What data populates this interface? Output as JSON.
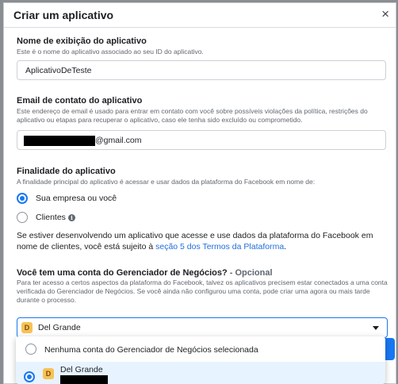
{
  "dialog": {
    "title": "Criar um aplicativo",
    "close_glyph": "×"
  },
  "display_name": {
    "title": "Nome de exibição do aplicativo",
    "description": "Este é o nome do aplicativo associado ao seu ID do aplicativo.",
    "value": "AplicativoDeTeste"
  },
  "contact_email": {
    "title": "Email de contato do aplicativo",
    "description": "Este endereço de email é usado para entrar em contato com você sobre possíveis violações da política, restrições do aplicativo ou etapas para recuperar o aplicativo, caso ele tenha sido excluído ou comprometido.",
    "value_suffix": "@gmail.com"
  },
  "purpose": {
    "title": "Finalidade do aplicativo",
    "description": "A finalidade principal do aplicativo é acessar e usar dados da plataforma do Facebook em nome de:",
    "options": [
      {
        "label": "Sua empresa ou você",
        "selected": true
      },
      {
        "label": "Clientes",
        "selected": false,
        "icon": "info-icon"
      }
    ],
    "note_prefix": "Se estiver desenvolvendo um aplicativo que acesse e use dados da plataforma do Facebook em nome de clientes, você está sujeito à ",
    "note_link": "seção 5 dos Termos da Plataforma",
    "note_suffix": "."
  },
  "business": {
    "title": "Você tem uma conta do Gerenciador de Negócios?",
    "optional": " - Opcional",
    "description": "Para ter acesso a certos aspectos da plataforma do Facebook, talvez os aplicativos precisem estar conectados a uma conta verificada do Gerenciador de Negócios. Se você ainda não configurou uma conta, pode criar uma agora ou mais tarde durante o processo.",
    "selected": {
      "badge": "D",
      "label": "Del Grande"
    },
    "dropdown": [
      {
        "label": "Nenhuma conta do Gerenciador de Negócios selecionada",
        "selected": false
      },
      {
        "badge": "D",
        "label": "Del Grande",
        "selected": true
      }
    ]
  },
  "colors": {
    "accent": "#1877f2",
    "link": "#216fdb",
    "badge": "#f7c257"
  }
}
